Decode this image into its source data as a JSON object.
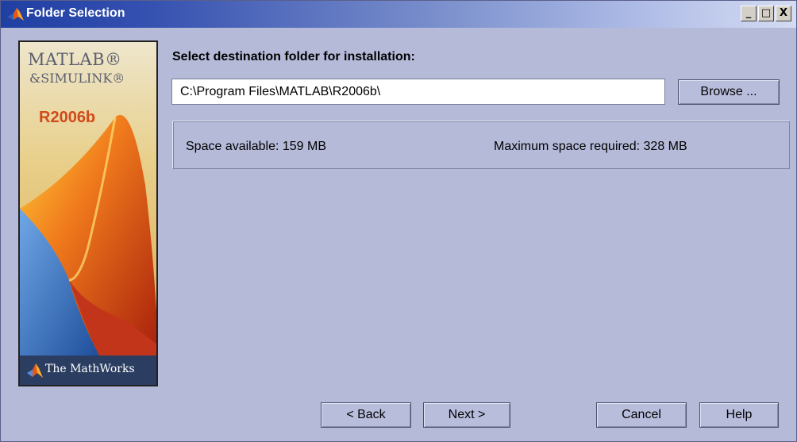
{
  "window": {
    "title": "Folder Selection",
    "controls": {
      "minimize": "_",
      "maximize": "□",
      "close": "X"
    },
    "icon": "matlab-membrane-icon"
  },
  "side_panel": {
    "brand_matlab": "MATLAB®",
    "brand_simulink": "&SIMULINK®",
    "release": "R2006b",
    "footer_text": "The MathWorks",
    "footer_icon": "mathworks-logo-icon",
    "colors": {
      "accent_orange": "#e8561c",
      "accent_red": "#b8250f",
      "accent_blue": "#2a63b8",
      "footer_bg": "#2b3e62"
    }
  },
  "main": {
    "heading": "Select destination folder for installation:",
    "path_value": "C:\\Program Files\\MATLAB\\R2006b\\",
    "browse_label": "Browse ...",
    "space_available": "Space available: 159 MB",
    "space_required": "Maximum space required: 328 MB"
  },
  "buttons": {
    "back": "< Back",
    "next": "Next >",
    "cancel": "Cancel",
    "help": "Help"
  }
}
